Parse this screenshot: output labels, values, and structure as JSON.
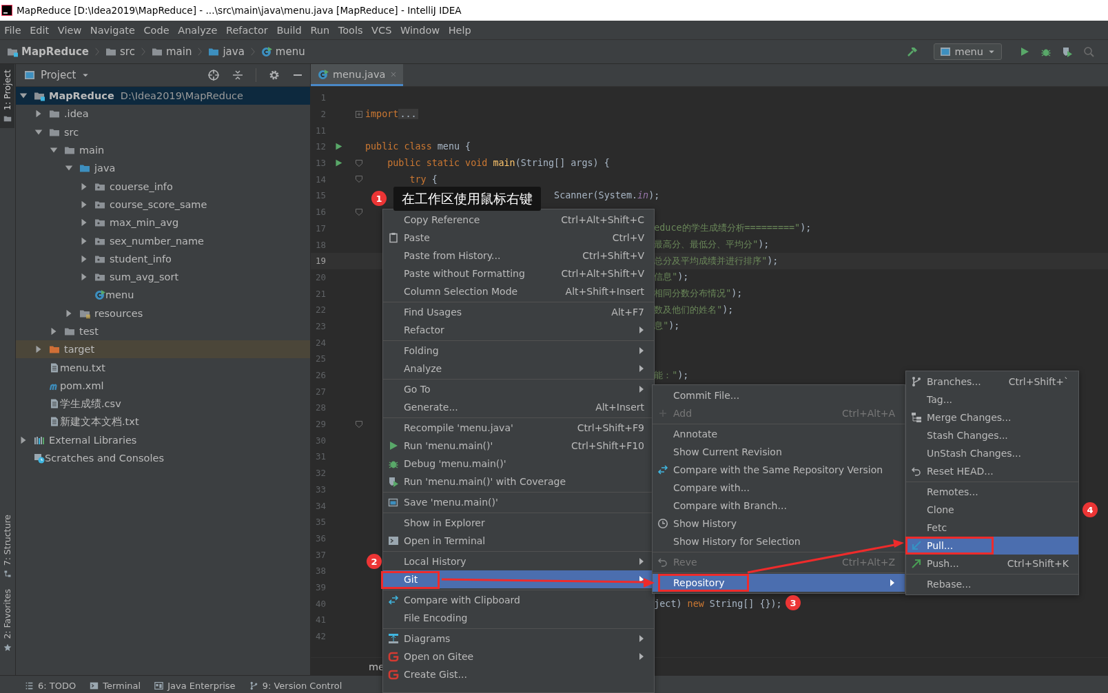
{
  "window": {
    "title": "MapReduce [D:\\Idea2019\\MapReduce] - ...\\src\\main\\java\\menu.java [MapReduce] - IntelliJ IDEA"
  },
  "menu_bar": [
    "File",
    "Edit",
    "View",
    "Navigate",
    "Code",
    "Analyze",
    "Refactor",
    "Build",
    "Run",
    "Tools",
    "VCS",
    "Window",
    "Help"
  ],
  "breadcrumbs": [
    {
      "label": "MapReduce",
      "kind": "module"
    },
    {
      "label": "src",
      "kind": "folder"
    },
    {
      "label": "main",
      "kind": "folder"
    },
    {
      "label": "java",
      "kind": "source"
    },
    {
      "label": "menu",
      "kind": "class"
    }
  ],
  "run_config": "menu",
  "side_tabs": [
    {
      "label": "1: Project",
      "kind": "project",
      "selected": true
    },
    {
      "label": "7: Structure",
      "kind": "structure",
      "selected": false
    },
    {
      "label": "2: Favorites",
      "kind": "favorites",
      "selected": false
    }
  ],
  "project": {
    "title": "Project",
    "tree": [
      {
        "label": "MapReduce",
        "detail": "D:\\Idea2019\\MapReduce",
        "kind": "module",
        "expanded": true,
        "selected": true,
        "hovered": false,
        "children": [
          {
            "label": ".idea",
            "kind": "folder",
            "expanded": false,
            "selected": false,
            "hovered": false
          },
          {
            "label": "src",
            "kind": "folder",
            "expanded": true,
            "selected": false,
            "hovered": false,
            "children": [
              {
                "label": "main",
                "kind": "folder",
                "expanded": true,
                "selected": false,
                "hovered": false,
                "children": [
                  {
                    "label": "java",
                    "kind": "source",
                    "expanded": true,
                    "selected": false,
                    "hovered": false,
                    "children": [
                      {
                        "label": "couerse_info",
                        "kind": "package",
                        "expanded": false,
                        "selected": false,
                        "hovered": false
                      },
                      {
                        "label": "course_score_same",
                        "kind": "package",
                        "expanded": false,
                        "selected": false,
                        "hovered": false
                      },
                      {
                        "label": "max_min_avg",
                        "kind": "package",
                        "expanded": false,
                        "selected": false,
                        "hovered": false
                      },
                      {
                        "label": "sex_number_name",
                        "kind": "package",
                        "expanded": false,
                        "selected": false,
                        "hovered": false
                      },
                      {
                        "label": "student_info",
                        "kind": "package",
                        "expanded": false,
                        "selected": false,
                        "hovered": false
                      },
                      {
                        "label": "sum_avg_sort",
                        "kind": "package",
                        "expanded": false,
                        "selected": false,
                        "hovered": false
                      },
                      {
                        "label": "menu",
                        "kind": "class",
                        "selected": false,
                        "hovered": false
                      }
                    ]
                  },
                  {
                    "label": "resources",
                    "kind": "resources",
                    "expanded": false,
                    "selected": false,
                    "hovered": false
                  }
                ]
              },
              {
                "label": "test",
                "kind": "folder",
                "expanded": false,
                "selected": false,
                "hovered": false
              }
            ]
          },
          {
            "label": "target",
            "kind": "excluded",
            "expanded": false,
            "selected": false,
            "hovered": true
          },
          {
            "label": "menu.txt",
            "kind": "text",
            "selected": false,
            "hovered": false
          },
          {
            "label": "pom.xml",
            "kind": "maven",
            "selected": false,
            "hovered": false
          },
          {
            "label": "学生成绩.csv",
            "kind": "text",
            "selected": false,
            "hovered": false
          },
          {
            "label": "新建文本文档.txt",
            "kind": "text",
            "selected": false,
            "hovered": false
          }
        ]
      },
      {
        "label": "External Libraries",
        "kind": "libraries",
        "expanded": false,
        "selected": false,
        "hovered": false
      },
      {
        "label": "Scratches and Consoles",
        "kind": "scratches",
        "selected": false,
        "hovered": false
      }
    ]
  },
  "editor": {
    "tabs": [
      {
        "label": "menu.java",
        "selected": true
      }
    ],
    "lines": [
      {
        "number": "1",
        "run": false,
        "fold": false,
        "current": false
      },
      {
        "number": "2",
        "run": false,
        "fold": true,
        "collapsed": true,
        "current": false,
        "parts": [
          {
            "kind": "keyword",
            "text": "import"
          },
          {
            "kind": "folded",
            "text": "..."
          }
        ]
      },
      {
        "number": "11",
        "run": false,
        "fold": false,
        "current": false
      },
      {
        "number": "12",
        "run": true,
        "fold": false,
        "current": false,
        "parts": [
          {
            "kind": "keyword",
            "text": "public class "
          },
          {
            "kind": "plain",
            "text": "menu {"
          }
        ]
      },
      {
        "number": "13",
        "run": true,
        "fold": true,
        "collapsed": false,
        "current": false,
        "parts": [
          {
            "kind": "keyword",
            "text": "    public static void "
          },
          {
            "kind": "method",
            "text": "main"
          },
          {
            "kind": "plain",
            "text": "(String[] args) {"
          }
        ]
      },
      {
        "number": "14",
        "run": false,
        "fold": true,
        "collapsed": false,
        "current": false,
        "parts": [
          {
            "kind": "keyword",
            "text": "        try"
          },
          {
            "kind": "plain",
            "text": " {"
          }
        ]
      },
      {
        "number": "15",
        "run": false,
        "fold": false,
        "current": false,
        "parts": [
          {
            "kind": "plain",
            "text": "                                  Scanner(System."
          },
          {
            "kind": "static",
            "text": "in"
          },
          {
            "kind": "plain",
            "text": ");"
          }
        ]
      },
      {
        "number": "16",
        "run": false,
        "fold": true,
        "collapsed": false,
        "current": false
      },
      {
        "number": "17",
        "run": false,
        "fold": false,
        "current": false,
        "parts": [
          {
            "kind": "string",
            "text": "                                                    educe的学生成绩分析=========\""
          },
          {
            "kind": "plain",
            "text": ");"
          }
        ]
      },
      {
        "number": "18",
        "run": false,
        "fold": false,
        "current": false,
        "parts": [
          {
            "kind": "string",
            "text": "                                                    最高分、最低分、平均分\""
          },
          {
            "kind": "plain",
            "text": ");"
          }
        ]
      },
      {
        "number": "19",
        "run": false,
        "fold": false,
        "current": true,
        "parts": [
          {
            "kind": "string",
            "text": "                                                    总分及平均成绩并进行排序\""
          },
          {
            "kind": "plain",
            "text": ");"
          }
        ]
      },
      {
        "number": "20",
        "run": false,
        "fold": false,
        "current": false,
        "parts": [
          {
            "kind": "string",
            "text": "                                                    信息\""
          },
          {
            "kind": "plain",
            "text": ");"
          }
        ]
      },
      {
        "number": "21",
        "run": false,
        "fold": false,
        "current": false,
        "parts": [
          {
            "kind": "string",
            "text": "                                                    相同分数分布情况\""
          },
          {
            "kind": "plain",
            "text": ");"
          }
        ]
      },
      {
        "number": "22",
        "run": false,
        "fold": false,
        "current": false,
        "parts": [
          {
            "kind": "string",
            "text": "                                                    数及他们的姓名\""
          },
          {
            "kind": "plain",
            "text": ");"
          }
        ]
      },
      {
        "number": "23",
        "run": false,
        "fold": false,
        "current": false,
        "parts": [
          {
            "kind": "string",
            "text": "                                                    息\""
          },
          {
            "kind": "plain",
            "text": ");"
          }
        ]
      },
      {
        "number": "24",
        "run": false,
        "fold": false,
        "current": false
      },
      {
        "number": "25",
        "run": false,
        "fold": false,
        "current": false
      },
      {
        "number": "26",
        "run": false,
        "fold": false,
        "current": false,
        "parts": [
          {
            "kind": "string",
            "text": "                                                    能：\""
          },
          {
            "kind": "plain",
            "text": ");"
          }
        ]
      },
      {
        "number": "27",
        "run": false,
        "fold": false,
        "current": false
      },
      {
        "number": "28",
        "run": false,
        "fold": false,
        "current": false
      },
      {
        "number": "29",
        "run": false,
        "fold": true,
        "collapsed": false,
        "current": false
      },
      {
        "number": "30",
        "run": false,
        "fold": false,
        "current": false
      },
      {
        "number": "31",
        "run": false,
        "fold": false,
        "current": false
      },
      {
        "number": "32",
        "run": false,
        "fold": false,
        "current": false
      },
      {
        "number": "33",
        "run": false,
        "fold": false,
        "current": false
      },
      {
        "number": "34",
        "run": false,
        "fold": false,
        "current": false
      },
      {
        "number": "35",
        "run": false,
        "fold": false,
        "current": false
      },
      {
        "number": "36",
        "run": false,
        "fold": false,
        "current": false
      },
      {
        "number": "37",
        "run": false,
        "fold": false,
        "current": false
      },
      {
        "number": "38",
        "run": false,
        "fold": false,
        "current": false
      },
      {
        "number": "39",
        "run": false,
        "fold": false,
        "current": false
      },
      {
        "number": "40",
        "run": false,
        "fold": false,
        "current": false,
        "parts": [
          {
            "kind": "plain",
            "text": "                                                    ject) "
          },
          {
            "kind": "keyword",
            "text": "new "
          },
          {
            "kind": "plain",
            "text": "String[] {});"
          }
        ]
      },
      {
        "number": "41",
        "run": false,
        "fold": false,
        "current": false
      },
      {
        "number": "42",
        "run": false,
        "fold": false,
        "current": false
      }
    ],
    "breadcrumb": "me"
  },
  "context_menu": {
    "groups": [
      [
        {
          "label": "Copy Reference",
          "shortcut": "Ctrl+Alt+Shift+C",
          "kind": "plain",
          "submenu": false,
          "selected": false
        },
        {
          "label": "Paste",
          "shortcut": "Ctrl+V",
          "kind": "paste",
          "submenu": false,
          "selected": false
        },
        {
          "label": "Paste from History...",
          "shortcut": "Ctrl+Shift+V",
          "kind": "plain",
          "submenu": false,
          "selected": false
        },
        {
          "label": "Paste without Formatting",
          "shortcut": "Ctrl+Alt+Shift+V",
          "kind": "plain",
          "submenu": false,
          "selected": false
        },
        {
          "label": "Column Selection Mode",
          "shortcut": "Alt+Shift+Insert",
          "kind": "plain",
          "submenu": false,
          "selected": false
        }
      ],
      [
        {
          "label": "Find Usages",
          "shortcut": "Alt+F7",
          "kind": "plain",
          "submenu": false,
          "selected": false
        },
        {
          "label": "Refactor",
          "kind": "plain",
          "submenu": true,
          "selected": false
        }
      ],
      [
        {
          "label": "Folding",
          "kind": "plain",
          "submenu": true,
          "selected": false
        },
        {
          "label": "Analyze",
          "kind": "plain",
          "submenu": true,
          "selected": false
        }
      ],
      [
        {
          "label": "Go To",
          "kind": "plain",
          "submenu": true,
          "selected": false
        },
        {
          "label": "Generate...",
          "shortcut": "Alt+Insert",
          "kind": "plain",
          "submenu": false,
          "selected": false
        }
      ],
      [
        {
          "label": "Recompile 'menu.java'",
          "shortcut": "Ctrl+Shift+F9",
          "kind": "plain",
          "submenu": false,
          "selected": false
        },
        {
          "label": "Run 'menu.main()'",
          "shortcut": "Ctrl+Shift+F10",
          "kind": "run",
          "submenu": false,
          "selected": false
        },
        {
          "label": "Debug 'menu.main()'",
          "kind": "debug",
          "submenu": false,
          "selected": false
        },
        {
          "label": "Run 'menu.main()' with Coverage",
          "kind": "coverage",
          "submenu": false,
          "selected": false
        }
      ],
      [
        {
          "label": "Save 'menu.main()'",
          "kind": "save",
          "submenu": false,
          "selected": false
        }
      ],
      [
        {
          "label": "Show in Explorer",
          "kind": "plain",
          "submenu": false,
          "selected": false
        },
        {
          "label": "Open in Terminal",
          "kind": "terminal",
          "submenu": false,
          "selected": false
        }
      ],
      [
        {
          "label": "Local History",
          "kind": "plain",
          "submenu": true,
          "selected": false
        },
        {
          "label": "Git",
          "kind": "plain",
          "submenu": true,
          "selected": true
        }
      ],
      [
        {
          "label": "Compare with Clipboard",
          "kind": "compare",
          "submenu": false,
          "selected": false
        },
        {
          "label": "File Encoding",
          "kind": "plain",
          "submenu": false,
          "selected": false
        }
      ],
      [
        {
          "label": "Diagrams",
          "kind": "diagram",
          "submenu": true,
          "selected": false
        },
        {
          "label": "Open on Gitee",
          "kind": "logo",
          "submenu": true,
          "selected": false
        },
        {
          "label": "Create Gist...",
          "kind": "logo",
          "submenu": false,
          "selected": false
        }
      ]
    ]
  },
  "git_menu": {
    "groups": [
      [
        {
          "label": "Commit File...",
          "kind": "plain",
          "submenu": false,
          "selected": false,
          "disabled": false
        },
        {
          "label": "Add",
          "shortcut": "Ctrl+Alt+A",
          "kind": "add",
          "submenu": false,
          "selected": false,
          "disabled": true
        }
      ],
      [
        {
          "label": "Annotate",
          "kind": "plain",
          "submenu": false,
          "selected": false,
          "disabled": false
        },
        {
          "label": "Show Current Revision",
          "kind": "plain",
          "submenu": false,
          "selected": false,
          "disabled": false
        },
        {
          "label": "Compare with the Same Repository Version",
          "kind": "compare",
          "submenu": false,
          "selected": false,
          "disabled": false
        },
        {
          "label": "Compare with...",
          "kind": "plain",
          "submenu": false,
          "selected": false,
          "disabled": false
        },
        {
          "label": "Compare with Branch...",
          "kind": "plain",
          "submenu": false,
          "selected": false,
          "disabled": false
        },
        {
          "label": "Show History",
          "kind": "history",
          "submenu": false,
          "selected": false,
          "disabled": false
        },
        {
          "label": "Show History for Selection",
          "kind": "plain",
          "submenu": false,
          "selected": false,
          "disabled": false
        }
      ],
      [
        {
          "label": "Reve",
          "shortcut": "Ctrl+Alt+Z",
          "kind": "revert",
          "submenu": false,
          "selected": false,
          "disabled": true
        }
      ],
      [
        {
          "label": "Repository",
          "kind": "plain",
          "submenu": true,
          "selected": true,
          "disabled": false
        }
      ]
    ]
  },
  "repository_menu": {
    "groups": [
      [
        {
          "label": "Branches...",
          "shortcut": "Ctrl+Shift+`",
          "kind": "branch",
          "submenu": false,
          "selected": false
        },
        {
          "label": "Tag...",
          "kind": "plain",
          "submenu": false,
          "selected": false
        },
        {
          "label": "Merge Changes...",
          "kind": "merge",
          "submenu": false,
          "selected": false
        },
        {
          "label": "Stash Changes...",
          "kind": "plain",
          "submenu": false,
          "selected": false
        },
        {
          "label": "UnStash Changes...",
          "kind": "plain",
          "submenu": false,
          "selected": false
        },
        {
          "label": "Reset HEAD...",
          "kind": "revert",
          "submenu": false,
          "selected": false
        }
      ],
      [
        {
          "label": "Remotes...",
          "kind": "plain",
          "submenu": false,
          "selected": false
        },
        {
          "label": "Clone",
          "kind": "plain",
          "submenu": false,
          "selected": false
        },
        {
          "label": "Fetc",
          "kind": "plain",
          "submenu": false,
          "selected": false
        },
        {
          "label": "Pull...",
          "kind": "pull",
          "submenu": false,
          "selected": true
        },
        {
          "label": "Push...",
          "shortcut": "Ctrl+Shift+K",
          "kind": "push",
          "submenu": false,
          "selected": false
        }
      ],
      [
        {
          "label": "Rebase...",
          "kind": "plain",
          "submenu": false,
          "selected": false
        }
      ]
    ]
  },
  "annotations": [
    {
      "number": "1",
      "text": "在工作区使用鼠标右键"
    },
    {
      "number": "2"
    },
    {
      "number": "3"
    },
    {
      "number": "4"
    }
  ],
  "tool_windows": [
    {
      "label": "6: TODO",
      "kind": "todo"
    },
    {
      "label": "Terminal",
      "kind": "terminal"
    },
    {
      "label": "Java Enterprise",
      "kind": "enterprise"
    },
    {
      "label": "9: Version Control",
      "kind": "vcs"
    }
  ]
}
